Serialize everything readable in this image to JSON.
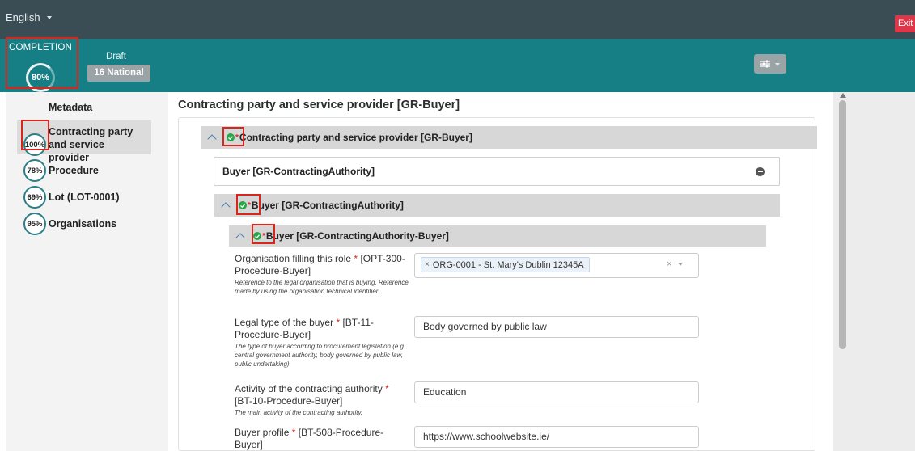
{
  "topbar": {
    "language": "English",
    "exit_label": "Exit"
  },
  "header": {
    "completion_label": "COMPLETION",
    "completion_percent": "80%",
    "status_label": "Draft",
    "notice_badge": "16 National"
  },
  "sidebar": {
    "title": "Metadata",
    "items": [
      {
        "percent": "100%",
        "label": "Contracting party and service provider",
        "active": true
      },
      {
        "percent": "78%",
        "label": "Procedure"
      },
      {
        "percent": "69%",
        "label": "Lot (LOT-0001)"
      },
      {
        "percent": "95%",
        "label": "Organisations"
      }
    ]
  },
  "main": {
    "page_title": "Contracting party and service provider [GR-Buyer]",
    "section1": {
      "title": "Contracting party and service provider  [GR-Buyer]"
    },
    "collapsed_row": {
      "title": "Buyer  [GR-ContractingAuthority]"
    },
    "section2": {
      "title": "Buyer  [GR-ContractingAuthority]"
    },
    "section3": {
      "title": "Buyer  [GR-ContractingAuthority-Buyer]"
    },
    "fields": [
      {
        "label": "Organisation filling this role",
        "code": "[OPT-300-Procedure-Buyer]",
        "description": "Reference to the legal organisation that is buying. Reference made by using the organisation technical identifier.",
        "value": "ORG-0001 - St. Mary's Dublin 12345A"
      },
      {
        "label": "Legal type of the buyer",
        "code": "[BT-11-Procedure-Buyer]",
        "description": "The type of buyer according to procurement legislation (e.g. central government authority, body governed by public law, public undertaking).",
        "value": "Body governed by public law"
      },
      {
        "label": "Activity of the contracting authority",
        "code": "[BT-10-Procedure-Buyer]",
        "description": "The main activity of the contracting authority.",
        "value": "Education"
      },
      {
        "label": "Buyer profile",
        "code": "[BT-508-Procedure-Buyer]",
        "description": "",
        "value": "https://www.schoolwebsite.ie/"
      }
    ]
  },
  "colors": {
    "topbar": "#3a4d55",
    "header_band": "#157f85",
    "exit_button": "#e0364a",
    "highlight_box": "#d9261c",
    "check_green": "#27a745"
  }
}
